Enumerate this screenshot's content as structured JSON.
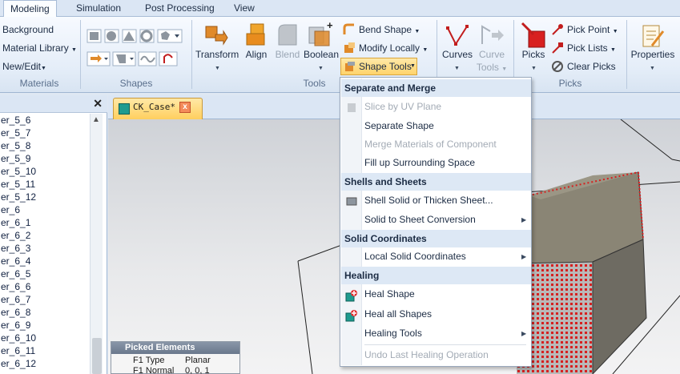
{
  "menu_tabs": [
    "Modeling",
    "Simulation",
    "Post Processing",
    "View"
  ],
  "ribbon": {
    "materials": {
      "items": [
        "Background",
        "Material Library",
        "New/Edit"
      ],
      "label": "Materials"
    },
    "shapes": {
      "label": "Shapes"
    },
    "tools": {
      "transform": "Transform",
      "align": "Align",
      "blend": "Blend",
      "boolean": "Boolean",
      "bend_shape": "Bend Shape",
      "modify_locally": "Modify Locally",
      "shape_tools": "Shape Tools",
      "label": "Tools"
    },
    "curves": {
      "curves": "Curves",
      "curve_tools_1": "Curve",
      "curve_tools_2": "Tools"
    },
    "picks": {
      "picks": "Picks",
      "pick_point": "Pick Point",
      "pick_lists": "Pick Lists",
      "clear_picks": "Clear Picks",
      "label": "Picks"
    },
    "properties": {
      "label": "Properties"
    }
  },
  "left_panel": {
    "items": [
      "er_5_6",
      "er_5_7",
      "er_5_8",
      "er_5_9",
      "er_5_10",
      "er_5_11",
      "er_5_12",
      "er_6",
      "er_6_1",
      "er_6_2",
      "er_6_3",
      "er_6_4",
      "er_6_5",
      "er_6_6",
      "er_6_7",
      "er_6_8",
      "er_6_9",
      "er_6_10",
      "er_6_11",
      "er_6_12"
    ]
  },
  "document": {
    "tab_title": "CK_Case*"
  },
  "picked_elements": {
    "title": "Picked Elements",
    "rows": [
      [
        "F1 Type",
        "Planar"
      ],
      [
        "F1 Normal",
        "0, 0, 1"
      ]
    ]
  },
  "shape_tools_menu": {
    "sections": [
      {
        "title": "Separate and Merge",
        "items": [
          {
            "label": "Slice by UV Plane",
            "disabled": true
          },
          {
            "label": "Separate Shape",
            "disabled": false
          },
          {
            "label": "Merge Materials of Component",
            "disabled": true
          },
          {
            "label": "Fill up Surrounding Space",
            "disabled": false
          }
        ]
      },
      {
        "title": "Shells and Sheets",
        "items": [
          {
            "label": "Shell Solid or Thicken Sheet...",
            "disabled": false
          },
          {
            "label": "Solid to Sheet Conversion",
            "disabled": false,
            "submenu": true
          }
        ]
      },
      {
        "title": "Solid Coordinates",
        "items": [
          {
            "label": "Local Solid Coordinates",
            "disabled": false,
            "submenu": true
          }
        ]
      },
      {
        "title": "Healing",
        "items": [
          {
            "label": "Heal Shape",
            "disabled": false
          },
          {
            "label": "Heal all Shapes",
            "disabled": false
          },
          {
            "label": "Healing Tools",
            "disabled": false,
            "submenu": true
          },
          {
            "label": "Undo Last Healing Operation",
            "disabled": true
          }
        ]
      }
    ]
  },
  "colors": {
    "accent": "#ffd36b",
    "red_pick": "#d32020",
    "ribbon_bg": "#e4edf8"
  }
}
